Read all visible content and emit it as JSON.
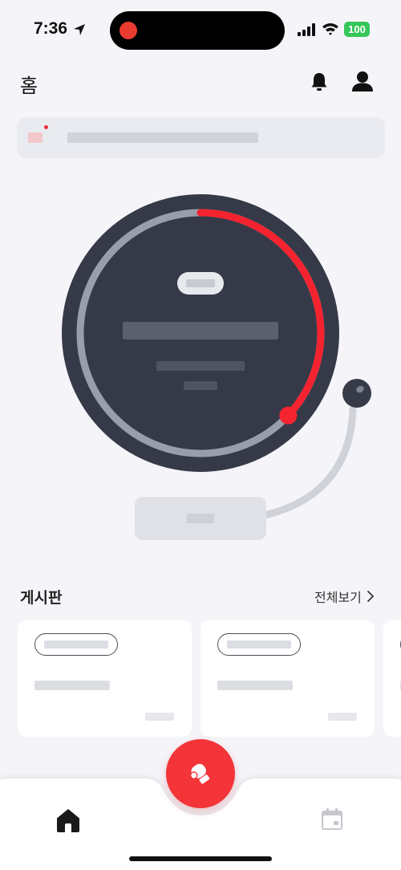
{
  "status_bar": {
    "time": "7:36",
    "battery": "100",
    "battery_color": "#35c759",
    "recording_color": "#ea3b30"
  },
  "header": {
    "title": "홈",
    "icons": [
      "bell-icon",
      "person-icon"
    ]
  },
  "notice_banner": {
    "loading": true,
    "badge_color": "#f0303a"
  },
  "timer": {
    "loading": true,
    "progress_fraction": 0.37,
    "progress_color": "#f5232f",
    "track_color": "#9a9eab",
    "dial_color": "#363a48"
  },
  "board": {
    "title": "게시판",
    "see_all_label": "전체보기",
    "cards_loading": 3
  },
  "bottom_nav": {
    "items": [
      "home-icon",
      "calendar-icon"
    ],
    "fab_icon": "boxing-glove-icon",
    "fab_color": "#f33438"
  }
}
